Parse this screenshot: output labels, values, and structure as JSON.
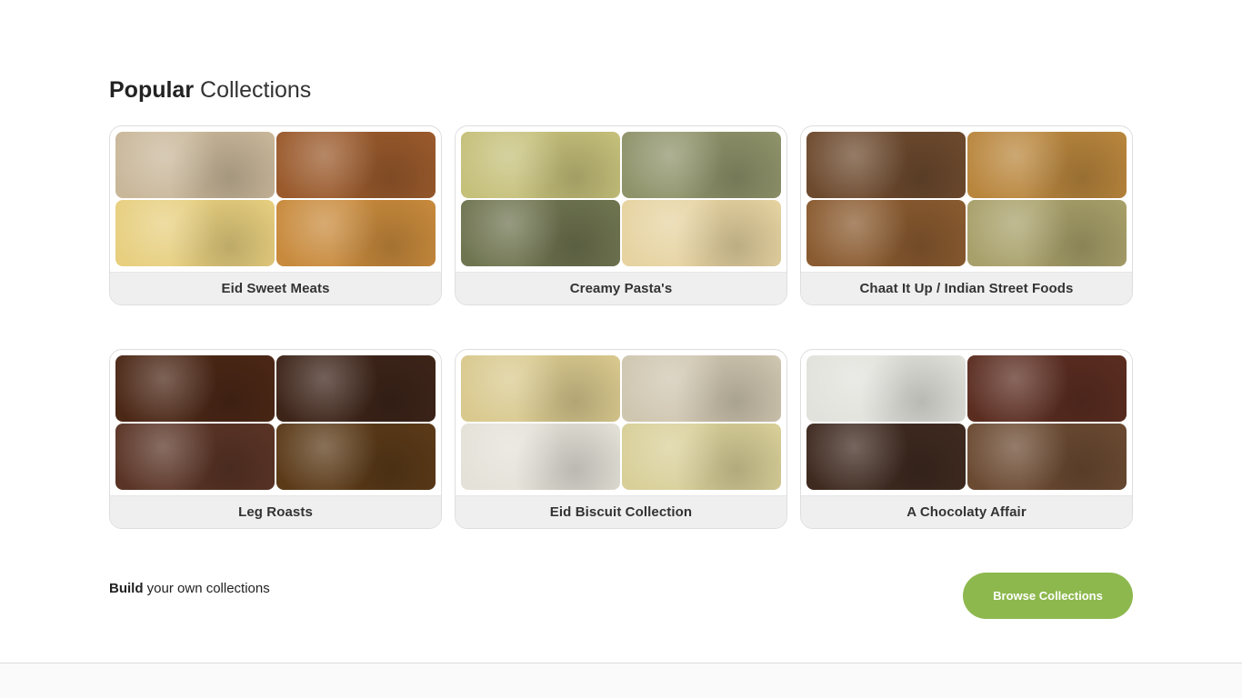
{
  "heading": {
    "strong": "Popular",
    "light": "Collections"
  },
  "collections": [
    {
      "title": "Eid Sweet Meats",
      "thumb_colors": [
        "#c9b79a",
        "#9a5a2c",
        "#e7cf7f",
        "#c88a3c"
      ]
    },
    {
      "title": "Creamy Pasta's",
      "thumb_colors": [
        "#c5c07a",
        "#8f936a",
        "#6f7450",
        "#e6d3a1"
      ]
    },
    {
      "title": "Chaat It Up / Indian Street Foods",
      "thumb_colors": [
        "#6d4a2e",
        "#b9863d",
        "#8a5b30",
        "#a8a06a"
      ]
    },
    {
      "title": "Leg Roasts",
      "thumb_colors": [
        "#4b2716",
        "#3d2419",
        "#5a3426",
        "#5b3a18"
      ]
    },
    {
      "title": "Eid Biscuit Collection",
      "thumb_colors": [
        "#d9c98e",
        "#cfc6b0",
        "#e4e1d8",
        "#d8cf98"
      ]
    },
    {
      "title": "A Chocolaty Affair",
      "thumb_colors": [
        "#e2e2dc",
        "#5b2d21",
        "#3f2a20",
        "#6b4a32"
      ]
    }
  ],
  "footer": {
    "build_strong": "Build",
    "build_rest": "your own collections",
    "browse_button": "Browse Collections"
  },
  "colors": {
    "accent": "#8db84e",
    "label_bg": "#efefef"
  }
}
